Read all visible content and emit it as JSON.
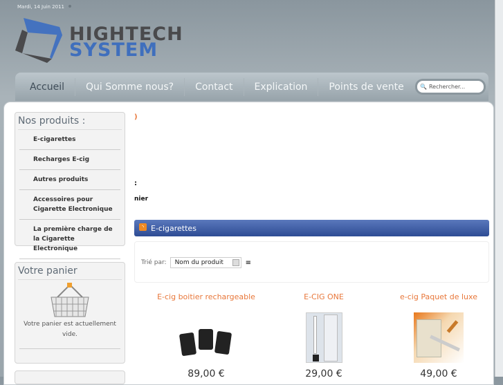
{
  "header": {
    "date": "Mardi, 14 Juin 2011",
    "logo_line1": "HIGHTECH",
    "logo_line2": "SYSTEM"
  },
  "nav": {
    "items": [
      "Accueil",
      "Qui Somme nous?",
      "Contact",
      "Explication",
      "Points de vente"
    ],
    "search_placeholder": "Rechercher..."
  },
  "sidebar": {
    "products_title": "Nos produits :",
    "products": [
      "E-cigarettes",
      "Recharges E-cig",
      "Autres produits",
      "Accessoires pour Cigarette Electronique",
      "La première charge de la Cigarette Electronique"
    ],
    "cart_title": "Votre panier",
    "cart_text": "Votre panier est actuellement vide."
  },
  "content": {
    "frag1": ")",
    "frag2": ":",
    "frag3": "nier",
    "category": "E-cigarettes",
    "sort_label": "Trié par:",
    "sort_value": "Nom du produit",
    "products": [
      {
        "name": "E-cig boitier rechargeable",
        "price": "89,00 €"
      },
      {
        "name": "E-CIG ONE",
        "price": "29,00 €"
      },
      {
        "name": "e-cig Paquet de luxe",
        "price": "49,00 €"
      }
    ]
  },
  "colors": {
    "accent": "#e8773a",
    "bar": "#3a589f",
    "logo_blue": "#3f6fbd"
  }
}
